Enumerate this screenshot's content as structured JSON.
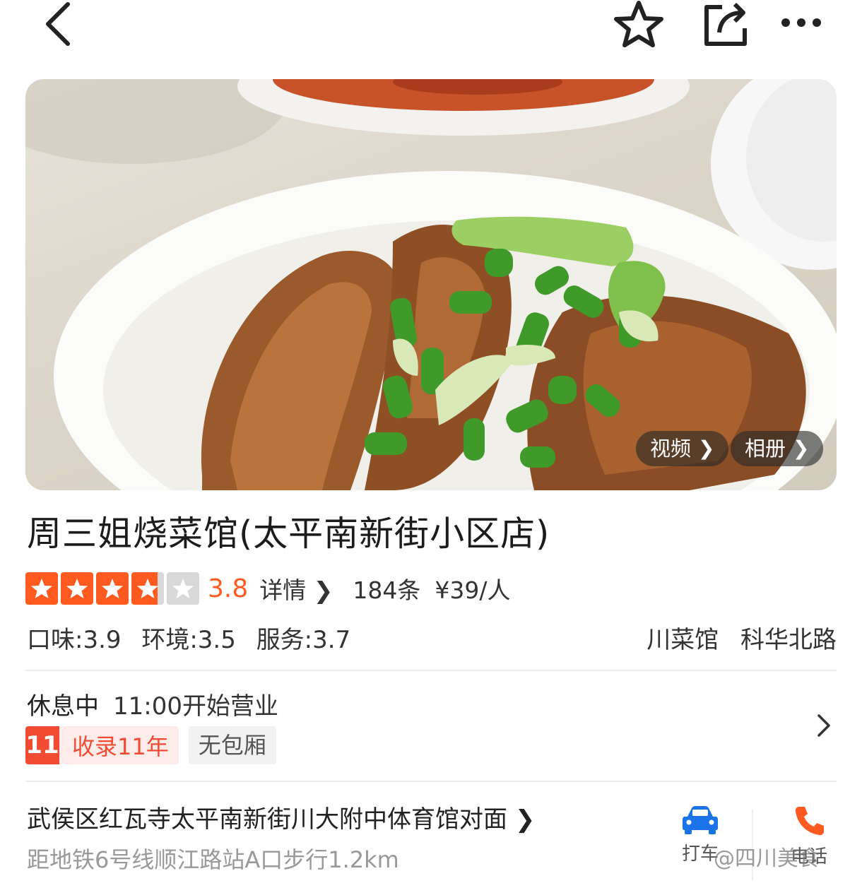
{
  "topbar": {
    "back_icon": "chevron-left-icon",
    "favorite_icon": "star-outline-icon",
    "share_icon": "share-icon",
    "more_icon": "more-dots-icon"
  },
  "hero": {
    "video_label": "视频",
    "album_label": "相册",
    "image_subject": "braised pork ribs with scallions"
  },
  "restaurant": {
    "name": "周三姐烧菜馆(太平南新街小区店)",
    "rating": 3.8,
    "rating_text": "3.8",
    "detail_label": "详情",
    "review_count": "184条",
    "price": "¥39/人",
    "scores": {
      "taste": "口味:3.9",
      "environment": "环境:3.5",
      "service": "服务:3.7"
    },
    "cuisine": "川菜馆",
    "area": "科华北路"
  },
  "status": {
    "state": "休息中",
    "hours": "11:00开始营业",
    "years_badge": "11",
    "years_text": "收录11年",
    "room_tag": "无包厢"
  },
  "address": {
    "line": "武侯区红瓦寺太平南新街川大附中体育馆对面",
    "metro": "距地铁6号线顺江路站A口步行1.2km",
    "taxi_label": "打车",
    "phone_label": "电话"
  },
  "watermark": "@四川美食",
  "colors": {
    "accent": "#ff5a1f",
    "star_empty": "#d8d8d8",
    "tag_red": "#f24b34",
    "taxi_blue": "#1a73e8"
  }
}
